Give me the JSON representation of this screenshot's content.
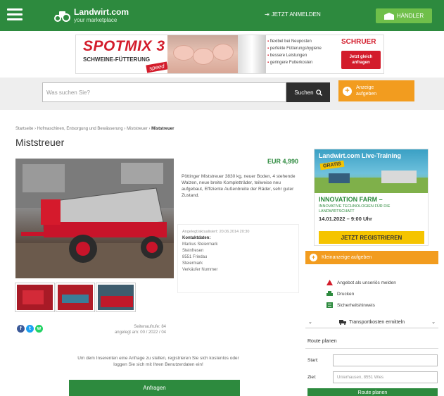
{
  "header": {
    "brand_name": "Landwirt.com",
    "brand_tagline": "your marketplace",
    "login_label": "JETZT ANMELDEN",
    "dealer_label": "HÄNDLER"
  },
  "banner": {
    "title": "SPOTMIX 3",
    "subtitle": "SCHWEINE-FÜTTERUNG",
    "speed": "speed",
    "features": [
      "flexibel bei Neuposten",
      "perfekte Fütterungshygiene",
      "bessere Leistungen",
      "geringere Futterkosten"
    ],
    "brand": "SCHRUER",
    "cta": "Jetzt gleich anfragen"
  },
  "search": {
    "placeholder": "Was suchen Sie?",
    "button_label": "Suchen",
    "post_label": "Anzeige aufgeben"
  },
  "breadcrumb": {
    "path": "Startseite › Hofmaschinen, Entsorgung und Bewässerung › Miststreuer › ",
    "current": "Miststreuer"
  },
  "listing": {
    "title": "Miststreuer",
    "price": "EUR 4,990",
    "description": "Pöttinger Miststreuer 3830 kg, neuer Boden, 4 stehende Walzen, neue breite Kompletträder, teilweise neu aufgebaut, Effiziente Außenbreite der Räder, sehr guter Zustand.",
    "listed_date": "Angelegt/aktualisiert: 20.06.2014 20:30",
    "contact_heading": "Kontaktdaten:",
    "contact_lines": [
      "Markus Steiermark",
      "Steinfresen",
      "8551 Friedau",
      "Steiermark",
      "Verkäufer Nummer"
    ],
    "views": "Seitenaufrufe: 84",
    "created": "angelegt am: 00 / 2022 / 04",
    "inquiry_text": "Um dem Inserenten eine Anfrage zu stellen, registrieren Sie sich kostenlos oder loggen Sie sich mit Ihren Benutzerdaten ein!",
    "inquiry_button": "Anfragen"
  },
  "sidebar": {
    "ad_headline": "Landwirt.com Live-Training",
    "ad_badge": "GRATIS",
    "ad_title": "INNOVATION FARM –",
    "ad_subtitle": "INNOVATIVE TECHNOLOGIEN FÜR DIE LANDWIRTSCHAFT",
    "ad_date": "14.01.2022 – 9:00 Uhr",
    "ad_button": "JETZT REGISTRIEREN",
    "post_label": "Kleinanzeige aufgeben",
    "report_label": "Angebot als unseriös melden",
    "print_label": "Drucken",
    "safety_label": "Sicherheitshinweis",
    "transport_label": "Transportkosten ermitteln",
    "route_heading": "Route planen",
    "start_label": "Start:",
    "dest_label": "Ziel:",
    "dest_value": "Unterhausen, 8551 Wies",
    "route_button": "Route planen"
  },
  "colors": {
    "brand_green": "#2d8a3e",
    "accent_orange": "#f29c1f",
    "banner_red": "#d31c2b"
  }
}
